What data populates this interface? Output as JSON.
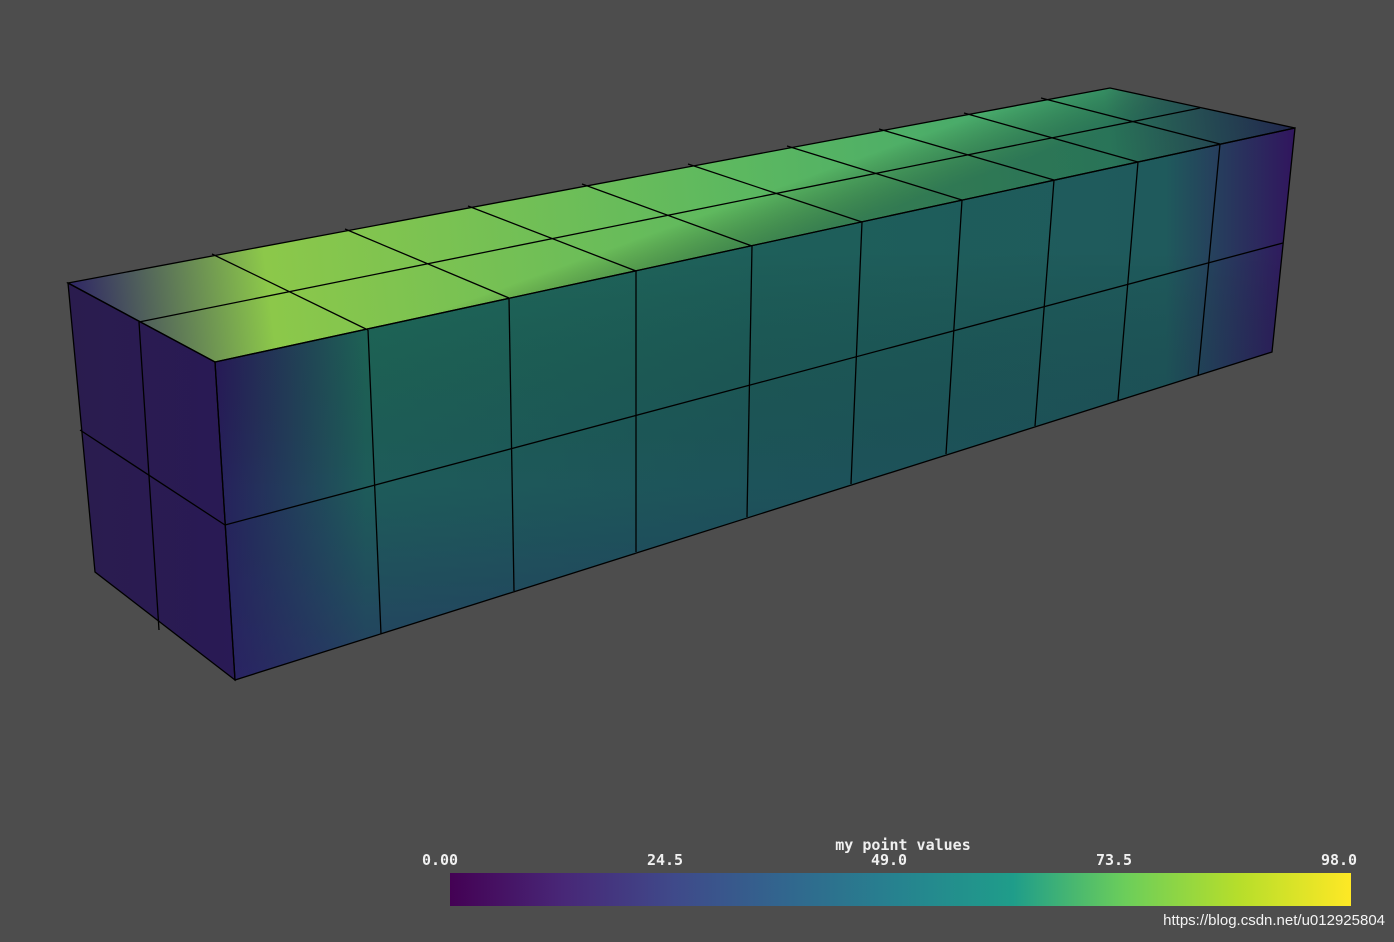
{
  "render": {
    "background": "#4d4d4d",
    "mesh_edge_color": "#000000",
    "colormap": "viridis",
    "colormap_stops": [
      "#440154",
      "#482777",
      "#3f4a8a",
      "#31678e",
      "#26838f",
      "#1f9d8a",
      "#6cce5a",
      "#b6de2b",
      "#fee825"
    ]
  },
  "scalar_bar": {
    "title": "my point values",
    "range": [
      0.0,
      98.0
    ],
    "tick_labels": [
      "0.00",
      "24.5",
      "49.0",
      "73.5",
      "98.0"
    ]
  },
  "watermark": "https://blog.csdn.net/u012925804"
}
